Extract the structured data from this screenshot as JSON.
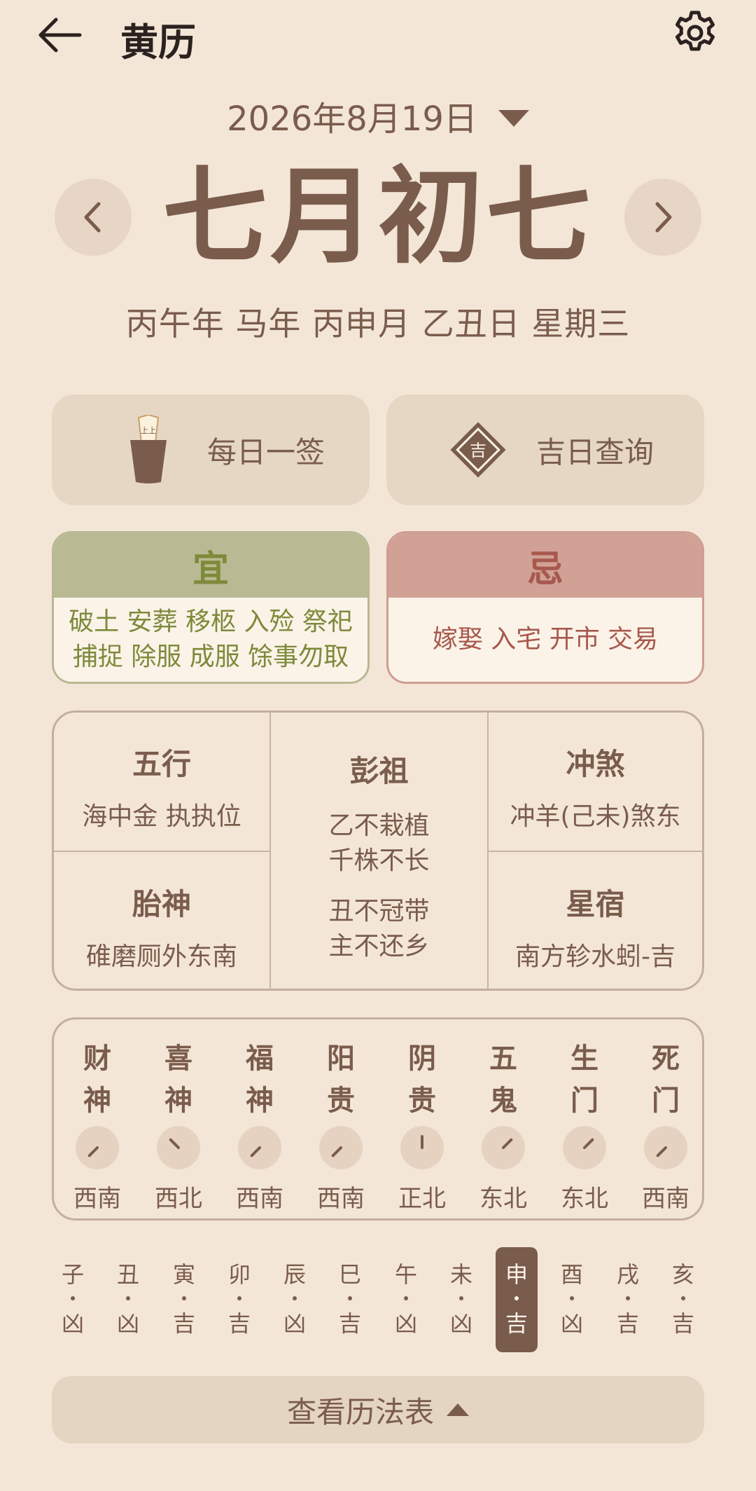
{
  "header": {
    "title": "黄历"
  },
  "date": {
    "solar": "2026年8月19日",
    "lunar": "七月初七",
    "ganzhi": "丙午年 马年 丙申月 乙丑日 星期三"
  },
  "actions": {
    "daily_sign": "每日一签",
    "lucky_day": "吉日查询",
    "lucky_badge": "吉"
  },
  "yi": {
    "title": "宜",
    "line1": "破土 安葬 移柩 入殓 祭祀",
    "line2": "捕捉 除服 成服 馀事勿取"
  },
  "ji": {
    "title": "忌",
    "text": "嫁娶 入宅 开市 交易"
  },
  "info": {
    "wuxing": {
      "title": "五行",
      "text": "海中金 执执位"
    },
    "pengzu": {
      "title": "彭祖",
      "line1": "乙不栽植",
      "line2": "千株不长",
      "line3": "丑不冠带",
      "line4": "主不还乡"
    },
    "chongsha": {
      "title": "冲煞",
      "text": "冲羊(己未)煞东"
    },
    "taishen": {
      "title": "胎神",
      "text": "碓磨厕外东南"
    },
    "xingxiu": {
      "title": "星宿",
      "text": "南方轸水蚓-吉"
    }
  },
  "gods": [
    {
      "n1": "财",
      "n2": "神",
      "dir": "西南",
      "angle": 225
    },
    {
      "n1": "喜",
      "n2": "神",
      "dir": "西北",
      "angle": 315
    },
    {
      "n1": "福",
      "n2": "神",
      "dir": "西南",
      "angle": 225
    },
    {
      "n1": "阳",
      "n2": "贵",
      "dir": "西南",
      "angle": 225
    },
    {
      "n1": "阴",
      "n2": "贵",
      "dir": "正北",
      "angle": 0
    },
    {
      "n1": "五",
      "n2": "鬼",
      "dir": "东北",
      "angle": 45
    },
    {
      "n1": "生",
      "n2": "门",
      "dir": "东北",
      "angle": 45
    },
    {
      "n1": "死",
      "n2": "门",
      "dir": "西南",
      "angle": 225
    }
  ],
  "hours": [
    {
      "b": "子",
      "l": "凶"
    },
    {
      "b": "丑",
      "l": "凶"
    },
    {
      "b": "寅",
      "l": "吉"
    },
    {
      "b": "卯",
      "l": "吉"
    },
    {
      "b": "辰",
      "l": "凶"
    },
    {
      "b": "巳",
      "l": "吉"
    },
    {
      "b": "午",
      "l": "凶"
    },
    {
      "b": "未",
      "l": "凶"
    },
    {
      "b": "申",
      "l": "吉",
      "active": true
    },
    {
      "b": "酉",
      "l": "凶"
    },
    {
      "b": "戌",
      "l": "吉"
    },
    {
      "b": "亥",
      "l": "吉"
    }
  ],
  "bottom": {
    "label": "查看历法表"
  }
}
